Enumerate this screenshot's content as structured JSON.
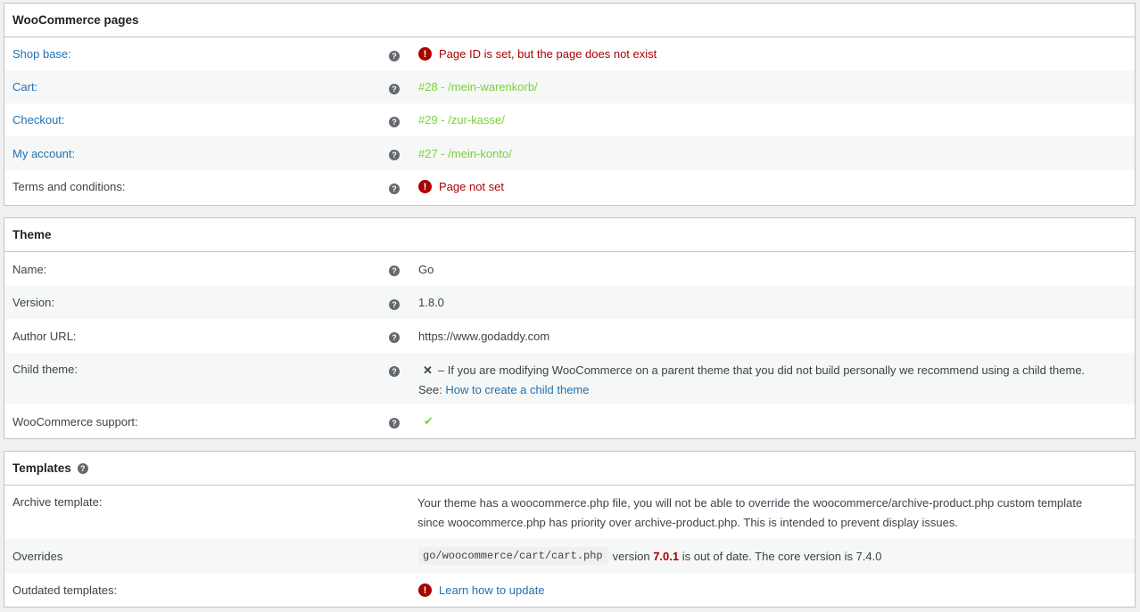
{
  "woo_pages": {
    "title": "WooCommerce pages",
    "rows": [
      {
        "label": "Shop base:",
        "value": "Page ID is set, but the page does not exist"
      },
      {
        "label": "Cart:",
        "value": "#28 - /mein-warenkorb/"
      },
      {
        "label": "Checkout:",
        "value": "#29 - /zur-kasse/"
      },
      {
        "label": "My account:",
        "value": "#27 - /mein-konto/"
      },
      {
        "label": "Terms and conditions:",
        "value": "Page not set"
      }
    ]
  },
  "theme": {
    "title": "Theme",
    "name_label": "Name:",
    "name_value": "Go",
    "version_label": "Version:",
    "version_value": "1.8.0",
    "author_label": "Author URL:",
    "author_value": "https://www.godaddy.com",
    "child_label": "Child theme:",
    "child_text": "– If you are modifying WooCommerce on a parent theme that you did not build personally we recommend using a child theme. See: ",
    "child_link": "How to create a child theme",
    "support_label": "WooCommerce support:"
  },
  "templates": {
    "title": "Templates",
    "archive_label": "Archive template:",
    "archive_value": "Your theme has a woocommerce.php file, you will not be able to override the woocommerce/archive-product.php custom template since woocommerce.php has priority over archive-product.php. This is intended to prevent display issues.",
    "overrides_label": "Overrides",
    "override_path": "go/woocommerce/cart/cart.php",
    "override_version_word": "version",
    "override_version": "7.0.1",
    "override_tail": "is out of date. The core version is 7.4.0",
    "outdated_label": "Outdated templates:",
    "outdated_link": "Learn how to update"
  },
  "icons": {
    "help": "?",
    "error": "!",
    "cross": "✕",
    "check": "✔"
  },
  "colors": {
    "link": "#2271b1",
    "ok": "#7ad03a",
    "error": "#aa0000"
  }
}
